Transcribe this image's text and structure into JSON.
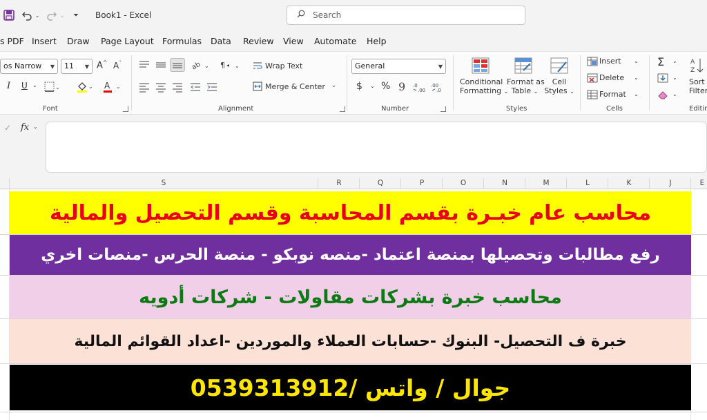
{
  "window": {
    "title": "Book1  -  Excel"
  },
  "search": {
    "placeholder": "Search"
  },
  "menu": {
    "items": [
      "s PDF",
      "Insert",
      "Draw",
      "Page Layout",
      "Formulas",
      "Data",
      "Review",
      "View",
      "Automate",
      "Help"
    ]
  },
  "ribbon": {
    "font": {
      "name": "os Narrow",
      "size": "11",
      "grow": "A",
      "shrink": "A",
      "italic": "I",
      "underline": "U",
      "group_label": "Font"
    },
    "alignment": {
      "wrap_text": "Wrap Text",
      "merge_center": "Merge & Center",
      "group_label": "Alignment"
    },
    "number": {
      "format": "General",
      "currency": "$",
      "percent": "%",
      "group_label": "Number"
    },
    "styles": {
      "conditional_line1": "Conditional",
      "conditional_line2": "Formatting",
      "format_table_line1": "Format as",
      "format_table_line2": "Table",
      "cell_styles_line1": "Cell",
      "cell_styles_line2": "Styles",
      "group_label": "Styles"
    },
    "cells": {
      "insert": "Insert",
      "delete": "Delete",
      "format": "Format",
      "group_label": "Cells"
    },
    "editing": {
      "sort_line1": "Sort",
      "sort_line2": "Filter",
      "group_label": "Editin"
    }
  },
  "formula_bar": {
    "fx": "fx"
  },
  "columns": [
    "S",
    "R",
    "Q",
    "P",
    "O",
    "N",
    "M",
    "L",
    "K",
    "J",
    "E"
  ],
  "rows": [
    {
      "text": "محاسب  عام خبـرة بقسم المحاسبة وقسم التحصيل والمالية",
      "bg": "#ffff00",
      "color": "#e8001c"
    },
    {
      "text": "رفع مطالبات وتحصيلها بمنصة اعتماد -منصه نوبكو - منصة الحرس -منصات اخري",
      "bg": "#6f2f9f",
      "color": "#ffffff"
    },
    {
      "text": "محاسب خبرة بشركات مقاولات - شركات أدويه",
      "bg": "#f2cfe8",
      "color": "#0b7a12"
    },
    {
      "text": "خبرة ف التحصيل- البنوك -حسابات العملاء والموردين -اعداد القوائم المالية",
      "bg": "#fbe1d6",
      "color": "#111111"
    },
    {
      "text": "جوال / واتس /0539313912",
      "bg": "#000000",
      "color": "#ffe600"
    }
  ]
}
